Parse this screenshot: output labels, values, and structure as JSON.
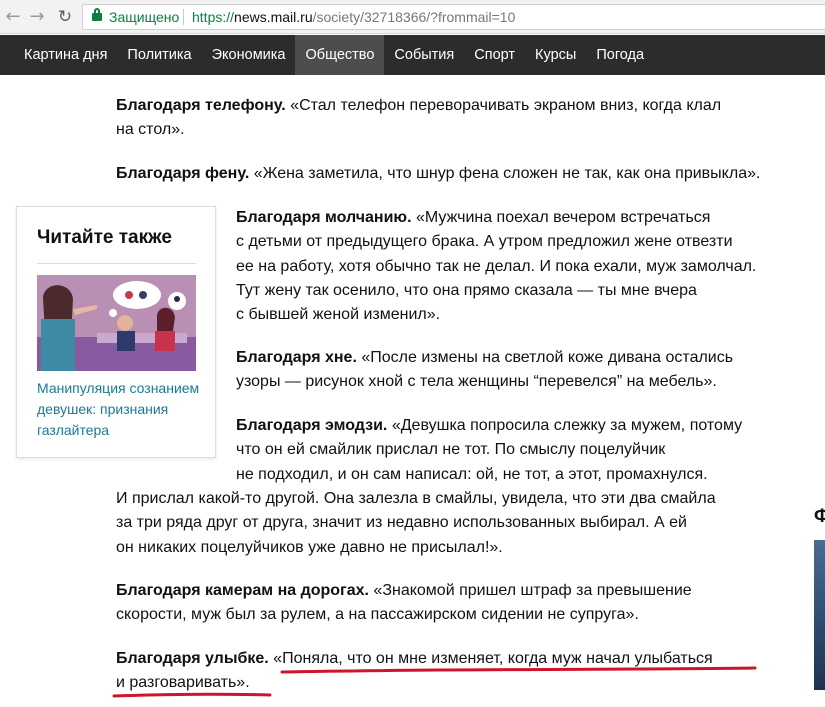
{
  "browser": {
    "secure_label": "Защищено",
    "url_scheme": "https://",
    "url_host": "news.mail.ru",
    "url_path": "/society/32718366/?frommail=10"
  },
  "nav": {
    "items": [
      "Картина дня",
      "Политика",
      "Экономика",
      "Общество",
      "События",
      "Спорт",
      "Курсы",
      "Погода"
    ],
    "active": "Общество"
  },
  "article": {
    "paragraphs": [
      {
        "lead": "Благодаря телефону.",
        "lines": [
          " «Стал телефон переворачивать экраном вниз, когда клал",
          "на стол»."
        ]
      },
      {
        "lead": "Благодаря фену.",
        "lines": [
          " «Жена заметила, что шнур фена сложен не так, как она привыкла»."
        ]
      },
      {
        "lead": "Благодаря молчанию.",
        "lines": [
          " «Мужчина поехал вечером встречаться",
          "с детьми от предыдущего брака. А утром предложил жене отвезти",
          "ее на работу, хотя обычно так не делал. И пока ехали, муж замолчал.",
          "Тут жену так осенило, что она прямо сказала — ты мне вчера",
          "с бывшей женой изменил»."
        ]
      },
      {
        "lead": "Благодаря хне.",
        "lines": [
          " «После измены на светлой коже дивана остались",
          "узоры — рисунок хной с тела женщины “перевелся” на мебель»."
        ]
      },
      {
        "lead": "Благодаря эмодзи.",
        "lines": [
          " «Девушка попросила слежку за мужем, потому",
          "что он ей смайлик прислал не тот. По смыслу поцелуйчик",
          "не подходил, и он сам написал: ой, не тот, а этот, промахнулся.",
          "И прислал какой-то другой. Она залезла в смайлы, увидела, что эти два смайла",
          "за три ряда друг от друга, значит из недавно использованных выбирал. А ей",
          "он никаких поцелуйчиков уже давно не присылал!»."
        ]
      },
      {
        "lead": "Благодаря камерам на дорогах.",
        "lines": [
          " «Знакомой пришел штраф за превышение",
          "скорости, муж был за рулем, а на пассажирском сидении не супруга»."
        ]
      },
      {
        "lead": "Благодаря улыбке.",
        "lines": [
          " «Поняла, что он мне изменяет, когда муж начал улыбаться",
          "и разговаривать»."
        ]
      }
    ]
  },
  "sidebar": {
    "title": "Читайте также",
    "link_text": "Манипуляция сознанием девушек: признания газлайтера"
  },
  "right_edge": {
    "partial_text": "Ф"
  },
  "colors": {
    "nav_bg": "#2c2c2c",
    "nav_active_bg": "#4d4d4d",
    "secure_green": "#0b8043",
    "link": "#1a7a99",
    "annotation_red": "#d0142c"
  }
}
